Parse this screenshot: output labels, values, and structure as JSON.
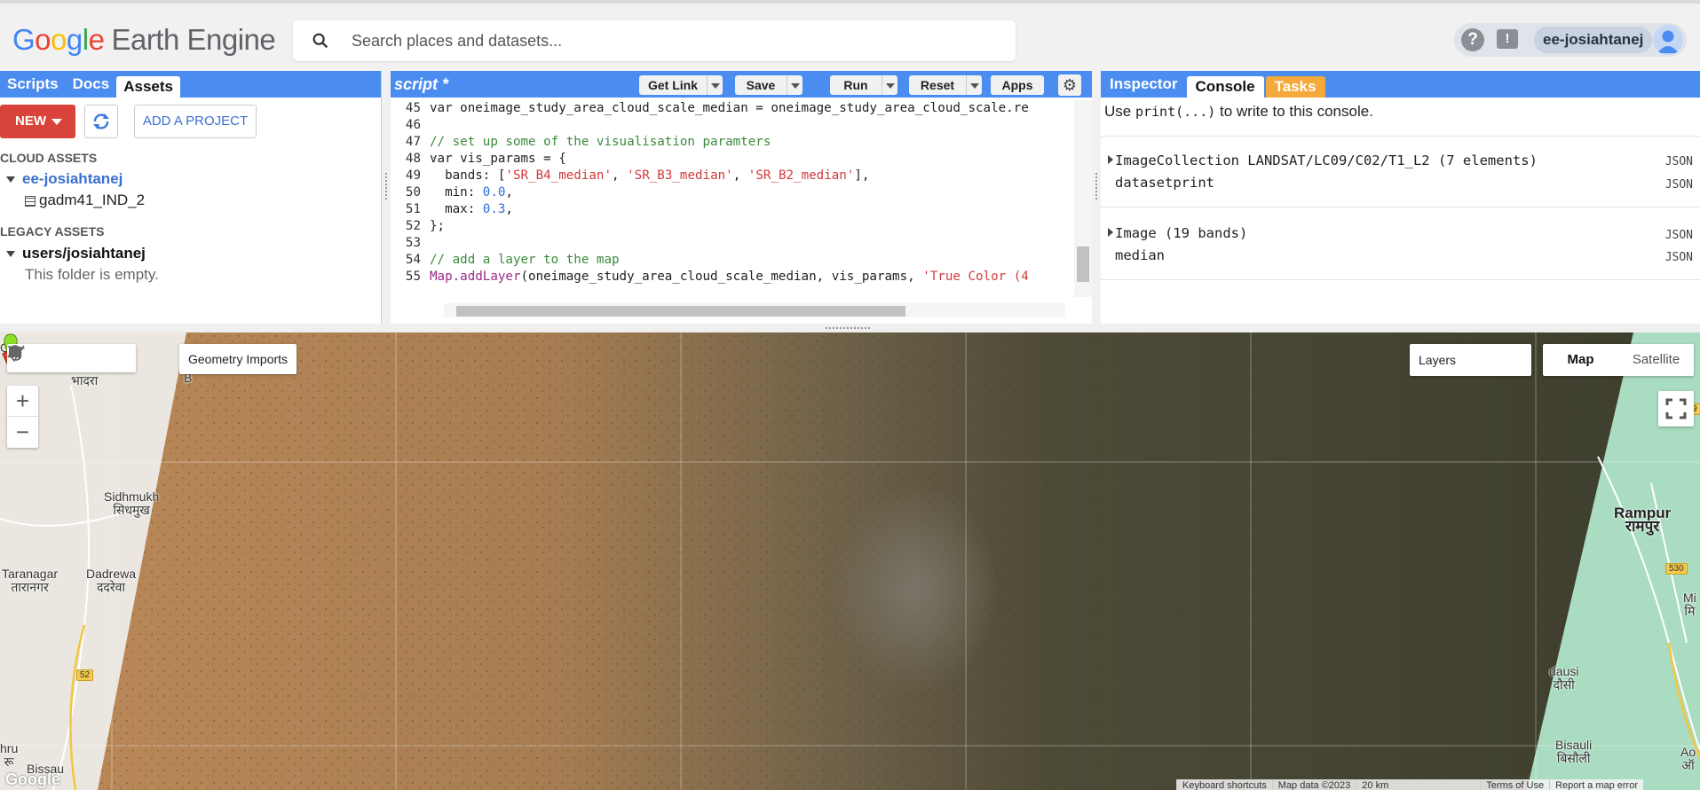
{
  "header": {
    "logo_google": [
      "G",
      "o",
      "o",
      "g",
      "l",
      "e"
    ],
    "logo_product": "Earth Engine",
    "search_placeholder": "Search places and datasets...",
    "help_icon": "?",
    "feedback_icon": "!",
    "username": "ee-josiahtanej"
  },
  "left_panel": {
    "tabs": [
      "Scripts",
      "Docs",
      "Assets"
    ],
    "active_tab": "Assets",
    "new_button": "NEW",
    "add_project_button": "ADD A PROJECT",
    "cloud_assets_label": "CLOUD ASSETS",
    "cloud_project": "ee-josiahtanej",
    "cloud_asset": "gadm41_IND_2",
    "legacy_assets_label": "LEGACY ASSETS",
    "legacy_folder": "users/josiahtanej",
    "legacy_empty": "This folder is empty."
  },
  "editor": {
    "title": "script *",
    "buttons": {
      "get_link": "Get Link",
      "save": "Save",
      "run": "Run",
      "reset": "Reset",
      "apps": "Apps"
    },
    "lines": [
      {
        "n": "45",
        "text": "var oneimage_study_area_cloud_scale_median = oneimage_study_area_cloud_scale.re"
      },
      {
        "n": "46",
        "text": ""
      },
      {
        "n": "47",
        "text": "// set up some of the visualisation paramters"
      },
      {
        "n": "48",
        "text": "var vis_params = {"
      },
      {
        "n": "49",
        "text": "  bands: ['SR_B4_median', 'SR_B3_median', 'SR_B2_median'],"
      },
      {
        "n": "50",
        "text": "  min: 0.0,"
      },
      {
        "n": "51",
        "text": "  max: 0.3,"
      },
      {
        "n": "52",
        "text": "};"
      },
      {
        "n": "53",
        "text": ""
      },
      {
        "n": "54",
        "text": "// add a layer to the map"
      },
      {
        "n": "55",
        "text": "Map.addLayer(oneimage_study_area_cloud_scale_median, vis_params, 'True Color (4"
      }
    ]
  },
  "console": {
    "tabs": [
      "Inspector",
      "Console",
      "Tasks"
    ],
    "active_tab": "Console",
    "hint_prefix": "Use ",
    "hint_code": "print(...)",
    "hint_suffix": " to write to this console.",
    "entries": [
      {
        "text": "ImageCollection LANDSAT/LC09/C02/T1_L2 (7 elements)",
        "expandable": true,
        "badge": "JSON"
      },
      {
        "text": "datasetprint",
        "expandable": false,
        "badge": "JSON"
      },
      {
        "text": "Image (19 bands)",
        "expandable": true,
        "badge": "JSON"
      },
      {
        "text": "median",
        "expandable": false,
        "badge": "JSON"
      }
    ]
  },
  "map": {
    "geometry_imports": "Geometry Imports",
    "zoom_in": "+",
    "zoom_out": "−",
    "layers_label": "Layers",
    "map_types": [
      "Map",
      "Satellite"
    ],
    "active_map_type": "Map",
    "labels": {
      "bhadra": "B\nभादरा",
      "sidhmukh": "Sidhmukh\nसिधमुख",
      "taranagar": "Taranagar\nतारानगर",
      "dadrewa": "Dadrewa\nददरेवा",
      "rampur": "Rampur\nरामपुर",
      "bisau": "Bissau",
      "churu": "hru\nरू",
      "bisauli": "Bisauli\nबिसौली",
      "dausi": "dausi\nदौसी",
      "mi": "Mi\nमि",
      "ao": "Ao\nऑ",
      "g": "G",
      "b": "B"
    },
    "roads": {
      "r52": "52",
      "r530": "530",
      "r9": "9"
    },
    "google_watermark": "Google",
    "footer": [
      "Keyboard shortcuts",
      "Map data ©2023",
      "20 km",
      "Terms of Use",
      "Report a map error"
    ]
  },
  "colors": {
    "accent_blue": "#4a8cf0",
    "new_button_red": "#d9443a",
    "tasks_orange": "#f4a93a"
  },
  "icons": {
    "search": "search-icon",
    "refresh": "refresh-icon",
    "gear": "gear-icon",
    "hand": "hand-pan-icon",
    "point": "point-marker-icon",
    "line": "polyline-icon",
    "polygon": "polygon-icon",
    "rectangle": "rectangle-icon",
    "fullscreen": "fullscreen-icon"
  }
}
